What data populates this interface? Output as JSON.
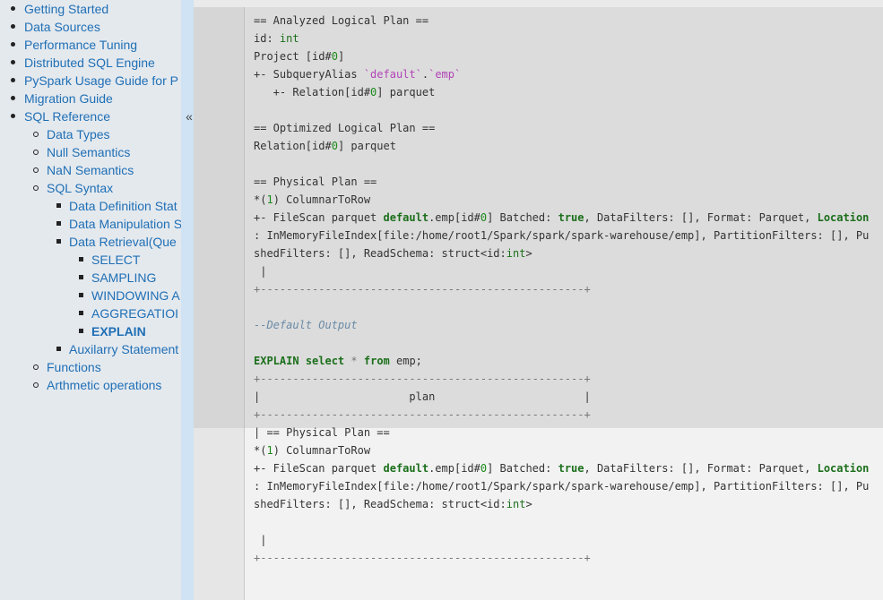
{
  "sidebar": {
    "items": [
      {
        "label": "Getting Started",
        "level": 1
      },
      {
        "label": "Data Sources",
        "level": 1
      },
      {
        "label": "Performance Tuning",
        "level": 1
      },
      {
        "label": "Distributed SQL Engine",
        "level": 1
      },
      {
        "label": "PySpark Usage Guide for P",
        "level": 1
      },
      {
        "label": "Migration Guide",
        "level": 1
      },
      {
        "label": "SQL Reference",
        "level": 1
      },
      {
        "label": "Data Types",
        "level": 2
      },
      {
        "label": "Null Semantics",
        "level": 2
      },
      {
        "label": "NaN Semantics",
        "level": 2
      },
      {
        "label": "SQL Syntax",
        "level": 2
      },
      {
        "label": "Data Definition Stat",
        "level": 3
      },
      {
        "label": "Data Manipulation S",
        "level": 3
      },
      {
        "label": "Data Retrieval(Que",
        "level": 3
      },
      {
        "label": "SELECT",
        "level": 4
      },
      {
        "label": "SAMPLING",
        "level": 4
      },
      {
        "label": "WINDOWING A",
        "level": 4
      },
      {
        "label": "AGGREGATIOI",
        "level": 4
      },
      {
        "label": "EXPLAIN",
        "level": 4,
        "active": true
      },
      {
        "label": "Auxilarry Statement",
        "level": 3
      },
      {
        "label": "Functions",
        "level": 2
      },
      {
        "label": "Arthmetic operations",
        "level": 2
      }
    ],
    "collapse_glyph": "«"
  },
  "colors": {
    "link": "#1f6fb5",
    "keyword": "#1b6f1b",
    "string": "#b344b8",
    "comment": "#6a8aa6"
  },
  "code": {
    "lines": [
      "== Analyzed Logical Plan ==",
      "id: int",
      "Project [id#0]",
      "+- SubqueryAlias `default`.`emp`",
      "   +- Relation[id#0] parquet",
      "",
      "== Optimized Logical Plan ==",
      "Relation[id#0] parquet",
      "",
      "== Physical Plan ==",
      "*(1) ColumnarToRow",
      "+- FileScan parquet default.emp[id#0] Batched: true, DataFilters: [], Format: Parquet, Location",
      ": InMemoryFileIndex[file:/home/root1/Spark/spark/spark-warehouse/emp], PartitionFilters: [], Pu",
      "shedFilters: [], ReadSchema: struct<id:int>",
      " |",
      "+--------------------------------------------------+",
      "",
      "--Default Output",
      "",
      "EXPLAIN select * from emp;",
      "+--------------------------------------------------+",
      "|                       plan                       |",
      "+--------------------------------------------------+",
      "| == Physical Plan ==",
      "*(1) ColumnarToRow",
      "+- FileScan parquet default.emp[id#0] Batched: true, DataFilters: [], Format: Parquet, Location",
      ": InMemoryFileIndex[file:/home/root1/Spark/spark/spark-warehouse/emp], PartitionFilters: [], Pu",
      "shedFilters: [], ReadSchema: struct<id:int>",
      "",
      " |",
      "+--------------------------------------------------+"
    ]
  }
}
